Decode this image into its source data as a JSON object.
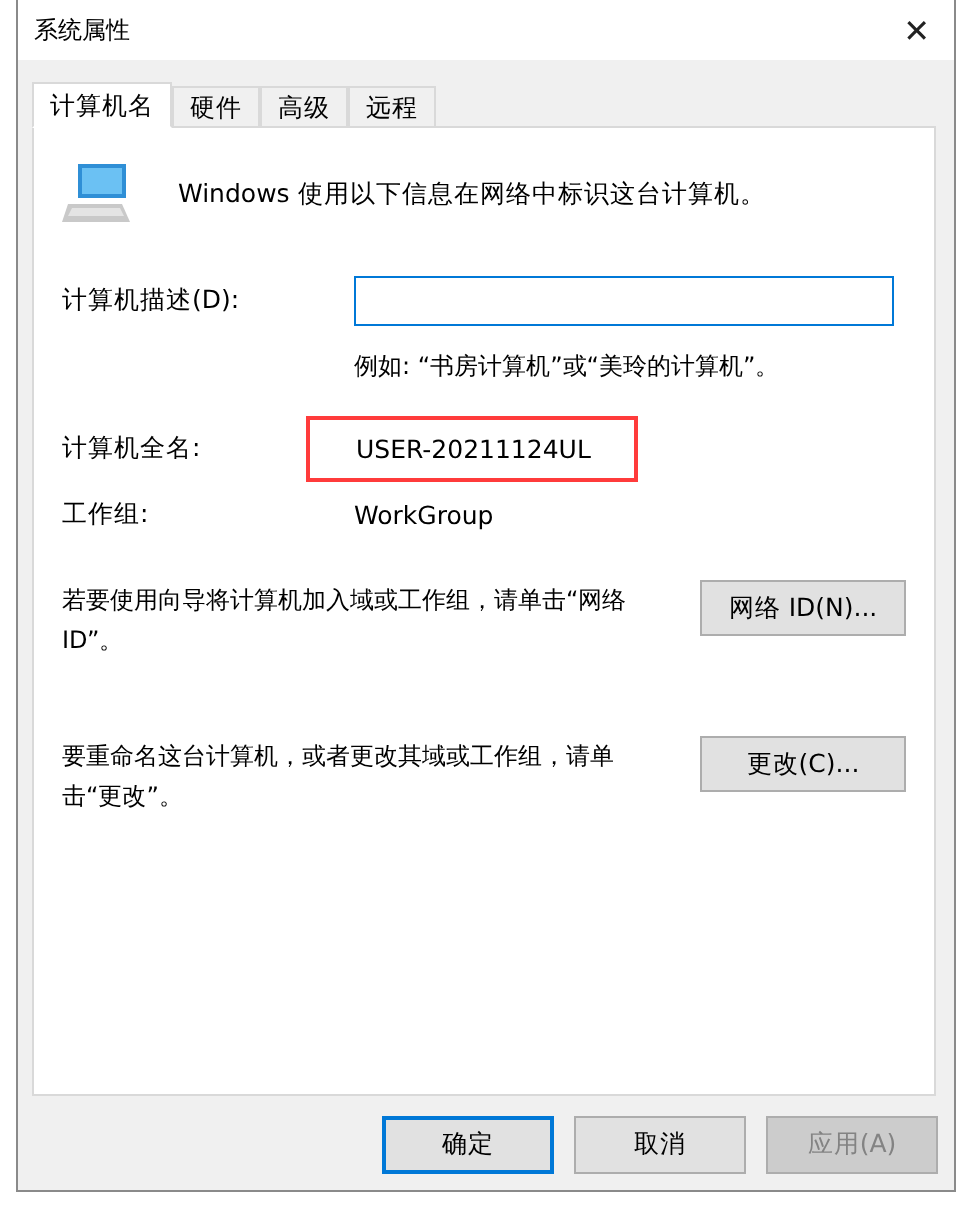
{
  "window": {
    "title": "系统属性",
    "close": "✕"
  },
  "tabs": [
    {
      "label": "计算机名",
      "selected": true
    },
    {
      "label": "硬件",
      "selected": false
    },
    {
      "label": "高级",
      "selected": false
    },
    {
      "label": "远程",
      "selected": false
    }
  ],
  "intro": "Windows 使用以下信息在网络中标识这台计算机。",
  "description": {
    "label": "计算机描述(D):",
    "hint": "例如: “书房计算机”或“美玲的计算机”。"
  },
  "full_name": {
    "label": "计算机全名:",
    "value": "USER-20211124UL",
    "highlighted": true
  },
  "workgroup": {
    "label": "工作组:",
    "value": "WorkGroup"
  },
  "actions": [
    {
      "text": "若要使用向导将计算机加入域或工作组，请单击“网络 ID”。",
      "button": "网络 ID(N)..."
    },
    {
      "text": "要重命名这台计算机，或者更改其域或工作组，请单击“更改”。",
      "button": "更改(C)..."
    }
  ],
  "buttons": [
    {
      "label": "确定",
      "default": true,
      "disabled": false
    },
    {
      "label": "取消",
      "default": false,
      "disabled": false
    },
    {
      "label": "应用(A)",
      "default": false,
      "disabled": true
    }
  ]
}
